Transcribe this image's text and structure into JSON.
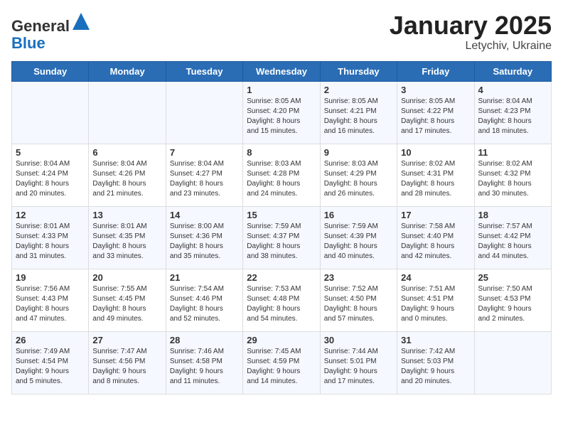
{
  "header": {
    "logo_line1": "General",
    "logo_line2": "Blue",
    "month": "January 2025",
    "location": "Letychiv, Ukraine"
  },
  "weekdays": [
    "Sunday",
    "Monday",
    "Tuesday",
    "Wednesday",
    "Thursday",
    "Friday",
    "Saturday"
  ],
  "weeks": [
    [
      {
        "day": "",
        "info": ""
      },
      {
        "day": "",
        "info": ""
      },
      {
        "day": "",
        "info": ""
      },
      {
        "day": "1",
        "info": "Sunrise: 8:05 AM\nSunset: 4:20 PM\nDaylight: 8 hours\nand 15 minutes."
      },
      {
        "day": "2",
        "info": "Sunrise: 8:05 AM\nSunset: 4:21 PM\nDaylight: 8 hours\nand 16 minutes."
      },
      {
        "day": "3",
        "info": "Sunrise: 8:05 AM\nSunset: 4:22 PM\nDaylight: 8 hours\nand 17 minutes."
      },
      {
        "day": "4",
        "info": "Sunrise: 8:04 AM\nSunset: 4:23 PM\nDaylight: 8 hours\nand 18 minutes."
      }
    ],
    [
      {
        "day": "5",
        "info": "Sunrise: 8:04 AM\nSunset: 4:24 PM\nDaylight: 8 hours\nand 20 minutes."
      },
      {
        "day": "6",
        "info": "Sunrise: 8:04 AM\nSunset: 4:26 PM\nDaylight: 8 hours\nand 21 minutes."
      },
      {
        "day": "7",
        "info": "Sunrise: 8:04 AM\nSunset: 4:27 PM\nDaylight: 8 hours\nand 23 minutes."
      },
      {
        "day": "8",
        "info": "Sunrise: 8:03 AM\nSunset: 4:28 PM\nDaylight: 8 hours\nand 24 minutes."
      },
      {
        "day": "9",
        "info": "Sunrise: 8:03 AM\nSunset: 4:29 PM\nDaylight: 8 hours\nand 26 minutes."
      },
      {
        "day": "10",
        "info": "Sunrise: 8:02 AM\nSunset: 4:31 PM\nDaylight: 8 hours\nand 28 minutes."
      },
      {
        "day": "11",
        "info": "Sunrise: 8:02 AM\nSunset: 4:32 PM\nDaylight: 8 hours\nand 30 minutes."
      }
    ],
    [
      {
        "day": "12",
        "info": "Sunrise: 8:01 AM\nSunset: 4:33 PM\nDaylight: 8 hours\nand 31 minutes."
      },
      {
        "day": "13",
        "info": "Sunrise: 8:01 AM\nSunset: 4:35 PM\nDaylight: 8 hours\nand 33 minutes."
      },
      {
        "day": "14",
        "info": "Sunrise: 8:00 AM\nSunset: 4:36 PM\nDaylight: 8 hours\nand 35 minutes."
      },
      {
        "day": "15",
        "info": "Sunrise: 7:59 AM\nSunset: 4:37 PM\nDaylight: 8 hours\nand 38 minutes."
      },
      {
        "day": "16",
        "info": "Sunrise: 7:59 AM\nSunset: 4:39 PM\nDaylight: 8 hours\nand 40 minutes."
      },
      {
        "day": "17",
        "info": "Sunrise: 7:58 AM\nSunset: 4:40 PM\nDaylight: 8 hours\nand 42 minutes."
      },
      {
        "day": "18",
        "info": "Sunrise: 7:57 AM\nSunset: 4:42 PM\nDaylight: 8 hours\nand 44 minutes."
      }
    ],
    [
      {
        "day": "19",
        "info": "Sunrise: 7:56 AM\nSunset: 4:43 PM\nDaylight: 8 hours\nand 47 minutes."
      },
      {
        "day": "20",
        "info": "Sunrise: 7:55 AM\nSunset: 4:45 PM\nDaylight: 8 hours\nand 49 minutes."
      },
      {
        "day": "21",
        "info": "Sunrise: 7:54 AM\nSunset: 4:46 PM\nDaylight: 8 hours\nand 52 minutes."
      },
      {
        "day": "22",
        "info": "Sunrise: 7:53 AM\nSunset: 4:48 PM\nDaylight: 8 hours\nand 54 minutes."
      },
      {
        "day": "23",
        "info": "Sunrise: 7:52 AM\nSunset: 4:50 PM\nDaylight: 8 hours\nand 57 minutes."
      },
      {
        "day": "24",
        "info": "Sunrise: 7:51 AM\nSunset: 4:51 PM\nDaylight: 9 hours\nand 0 minutes."
      },
      {
        "day": "25",
        "info": "Sunrise: 7:50 AM\nSunset: 4:53 PM\nDaylight: 9 hours\nand 2 minutes."
      }
    ],
    [
      {
        "day": "26",
        "info": "Sunrise: 7:49 AM\nSunset: 4:54 PM\nDaylight: 9 hours\nand 5 minutes."
      },
      {
        "day": "27",
        "info": "Sunrise: 7:47 AM\nSunset: 4:56 PM\nDaylight: 9 hours\nand 8 minutes."
      },
      {
        "day": "28",
        "info": "Sunrise: 7:46 AM\nSunset: 4:58 PM\nDaylight: 9 hours\nand 11 minutes."
      },
      {
        "day": "29",
        "info": "Sunrise: 7:45 AM\nSunset: 4:59 PM\nDaylight: 9 hours\nand 14 minutes."
      },
      {
        "day": "30",
        "info": "Sunrise: 7:44 AM\nSunset: 5:01 PM\nDaylight: 9 hours\nand 17 minutes."
      },
      {
        "day": "31",
        "info": "Sunrise: 7:42 AM\nSunset: 5:03 PM\nDaylight: 9 hours\nand 20 minutes."
      },
      {
        "day": "",
        "info": ""
      }
    ]
  ]
}
